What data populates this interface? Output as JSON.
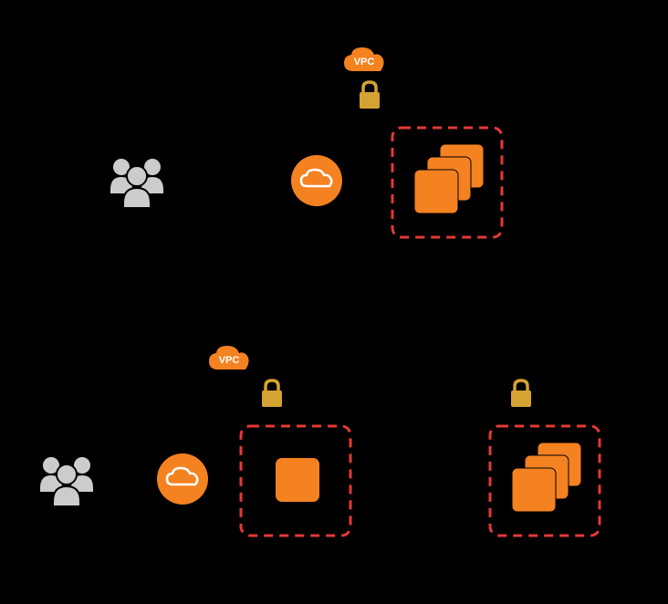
{
  "upper": {
    "vpc_label": "VPC"
  },
  "lower": {
    "vpc_label": "VPC"
  },
  "colors": {
    "orange": "#F58220",
    "lock": "#D4A332",
    "gray": "#CCCCCC",
    "red": "#E53935"
  }
}
